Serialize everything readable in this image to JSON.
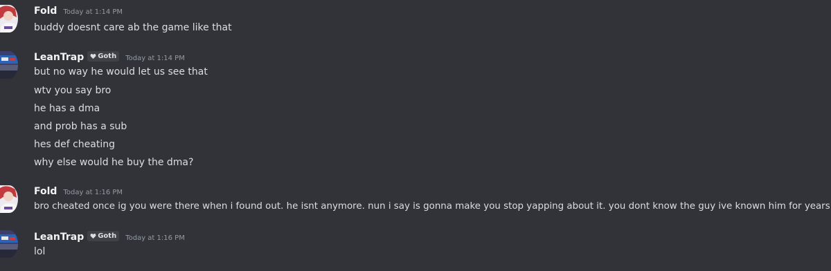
{
  "messages": [
    {
      "username": "Fold",
      "timestamp": "Today at 1:14 PM",
      "lines": [
        "buddy doesnt care ab the game like that"
      ]
    },
    {
      "username": "LeanTrap",
      "tag": "Goth",
      "timestamp": "Today at 1:14 PM",
      "lines": [
        "but no way he would let us see that",
        "wtv you say bro",
        "he has a dma",
        "and prob has a sub",
        "hes def cheating",
        "why else would he buy the dma?"
      ]
    },
    {
      "username": "Fold",
      "timestamp": "Today at 1:16 PM",
      "lines": [
        "bro cheated once ig you were there when i found out. he isnt anymore. nun i say is gonna make you stop yapping about it. you dont know the guy ive known him for years"
      ]
    },
    {
      "username": "LeanTrap",
      "tag": "Goth",
      "timestamp": "Today at 1:16 PM",
      "lines": [
        "lol"
      ]
    }
  ],
  "colors": {
    "background": "#313338",
    "username": "#f2f3f5",
    "message_text": "#dbdee1",
    "timestamp": "#949ba4",
    "tag_background": "#3f4147"
  }
}
